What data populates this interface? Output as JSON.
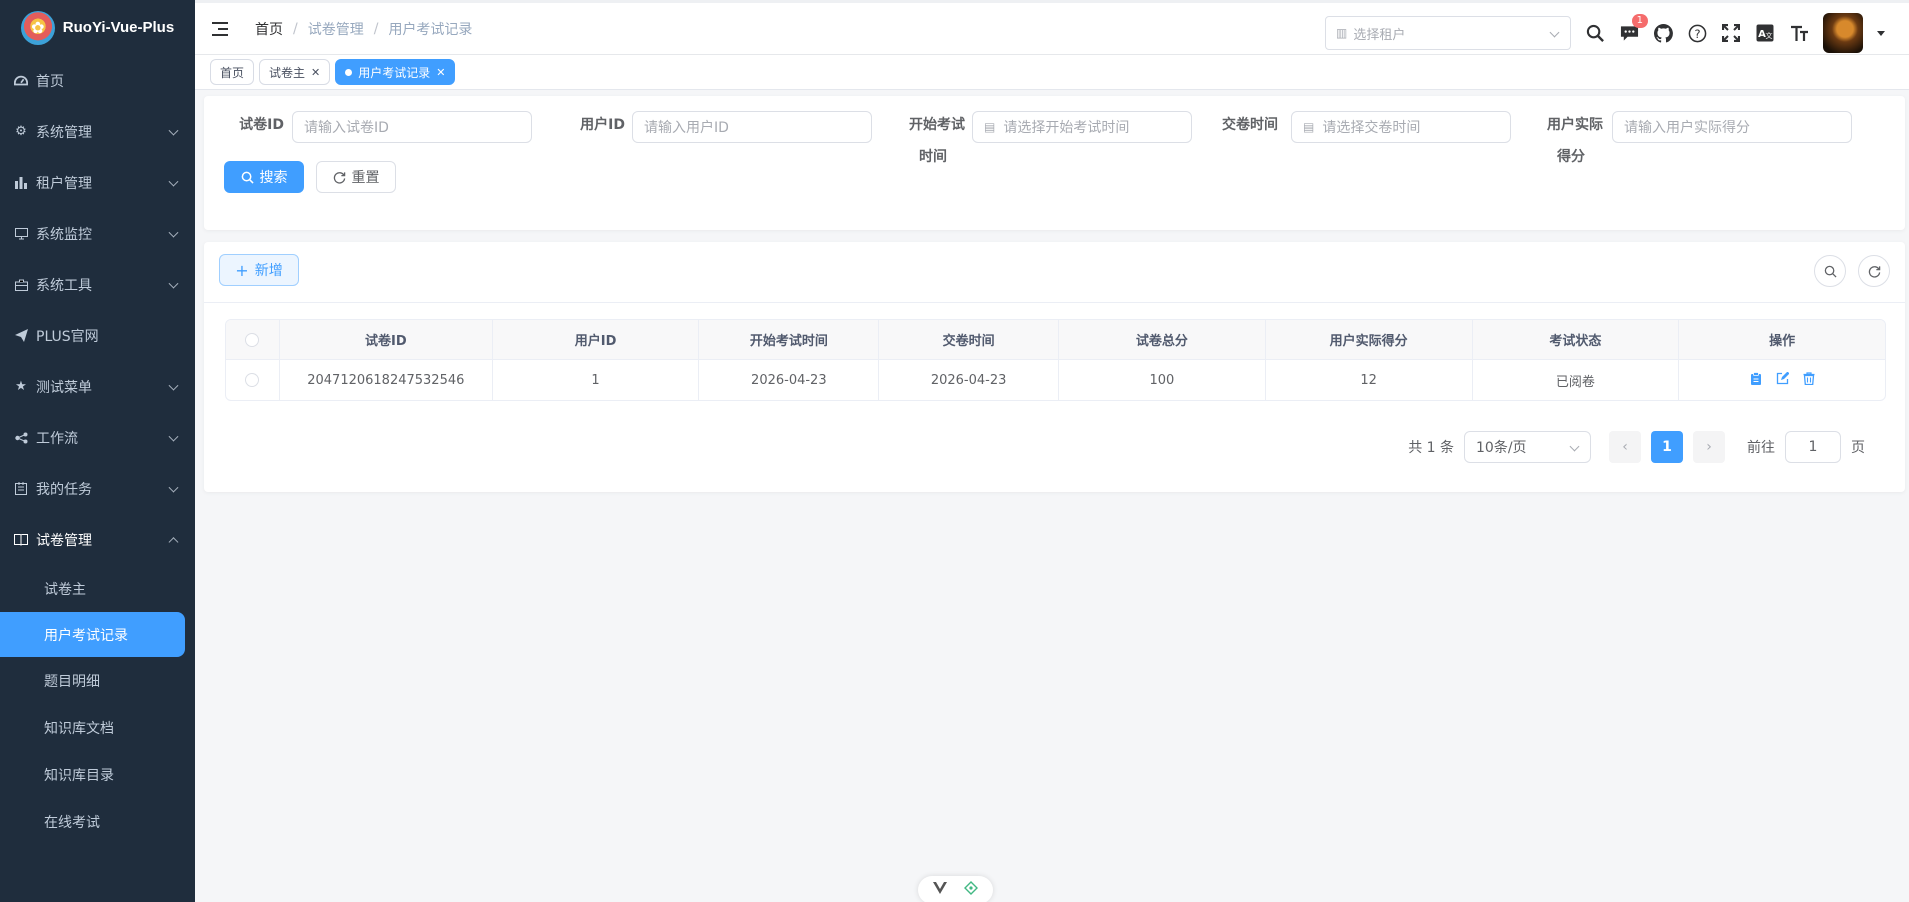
{
  "app": {
    "title": "RuoYi-Vue-Plus"
  },
  "sidebar": {
    "items": [
      {
        "label": "首页",
        "icon": "dashboard-icon"
      },
      {
        "label": "系统管理",
        "icon": "gear-icon"
      },
      {
        "label": "租户管理",
        "icon": "chart-icon"
      },
      {
        "label": "系统监控",
        "icon": "monitor-icon"
      },
      {
        "label": "系统工具",
        "icon": "toolbox-icon"
      },
      {
        "label": "PLUS官网",
        "icon": "send-icon"
      },
      {
        "label": "测试菜单",
        "icon": "star-icon"
      },
      {
        "label": "工作流",
        "icon": "workflow-icon"
      },
      {
        "label": "我的任务",
        "icon": "task-icon"
      },
      {
        "label": "试卷管理",
        "icon": "book-icon"
      }
    ],
    "subitems": [
      {
        "label": "试卷主"
      },
      {
        "label": "用户考试记录"
      },
      {
        "label": "题目明细"
      },
      {
        "label": "知识库文档"
      },
      {
        "label": "知识库目录"
      },
      {
        "label": "在线考试"
      }
    ]
  },
  "header": {
    "breadcrumb": [
      "首页",
      "试卷管理",
      "用户考试记录"
    ],
    "tenant_placeholder": "选择租户",
    "message_badge": "1"
  },
  "tags": [
    {
      "label": "首页"
    },
    {
      "label": "试卷主"
    },
    {
      "label": "用户考试记录"
    }
  ],
  "search": {
    "paper_id_label": "试卷ID",
    "paper_id_placeholder": "请输入试卷ID",
    "user_id_label": "用户ID",
    "user_id_placeholder": "请输入用户ID",
    "start_time_label_1": "开始考试",
    "start_time_label_2": "时间",
    "start_time_placeholder": "请选择开始考试时间",
    "submit_time_label": "交卷时间",
    "submit_time_placeholder": "请选择交卷时间",
    "score_label_1": "用户实际",
    "score_label_2": "得分",
    "score_placeholder": "请输入用户实际得分",
    "search_btn": "搜索",
    "reset_btn": "重置"
  },
  "toolbar": {
    "add_btn": "新增"
  },
  "table": {
    "columns": [
      "试卷ID",
      "用户ID",
      "开始考试时间",
      "交卷时间",
      "试卷总分",
      "用户实际得分",
      "考试状态",
      "操作"
    ],
    "rows": [
      {
        "paper_id": "2047120618247532546",
        "user_id": "1",
        "start_time": "2026-04-23",
        "submit_time": "2026-04-23",
        "total": "100",
        "score": "12",
        "status": "已阅卷"
      }
    ]
  },
  "pagination": {
    "total_text": "共 1 条",
    "page_size": "10条/页",
    "current_page": "1",
    "goto_label": "前往",
    "goto_value": "1",
    "page_unit": "页"
  },
  "colors": {
    "primary": "#409eff",
    "sidebar_bg": "#1f2d3d",
    "badge": "#f56c6c"
  }
}
